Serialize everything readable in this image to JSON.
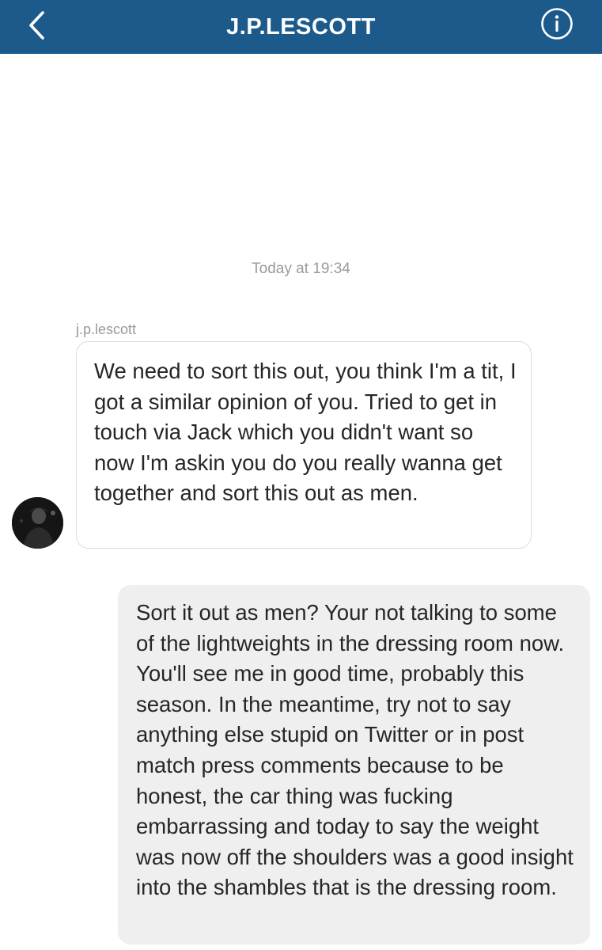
{
  "header": {
    "title": "J.P.LESCOTT",
    "back_icon": "chevron-left-icon",
    "info_icon": "info-icon",
    "background_color": "#1d5a8c"
  },
  "conversation": {
    "timestamp": "Today at 19:34",
    "messages": [
      {
        "direction": "incoming",
        "sender": "j.p.lescott",
        "text": "We need to sort this out, you think I'm a tit, I got a similar opinion of you. Tried to get in touch via Jack which you didn't want so now I'm askin you do you really wanna get together and sort this out as men."
      },
      {
        "direction": "outgoing",
        "text": "Sort it out as men? Your not talking to some of the lightweights in the dressing room now. You'll see me in good time, probably this season. In the meantime, try not to say anything else stupid on Twitter or in post match press comments because to be honest, the car thing was fucking embarrassing and today to say the weight was now off the shoulders was a good insight into the shambles that is the dressing room."
      }
    ]
  }
}
